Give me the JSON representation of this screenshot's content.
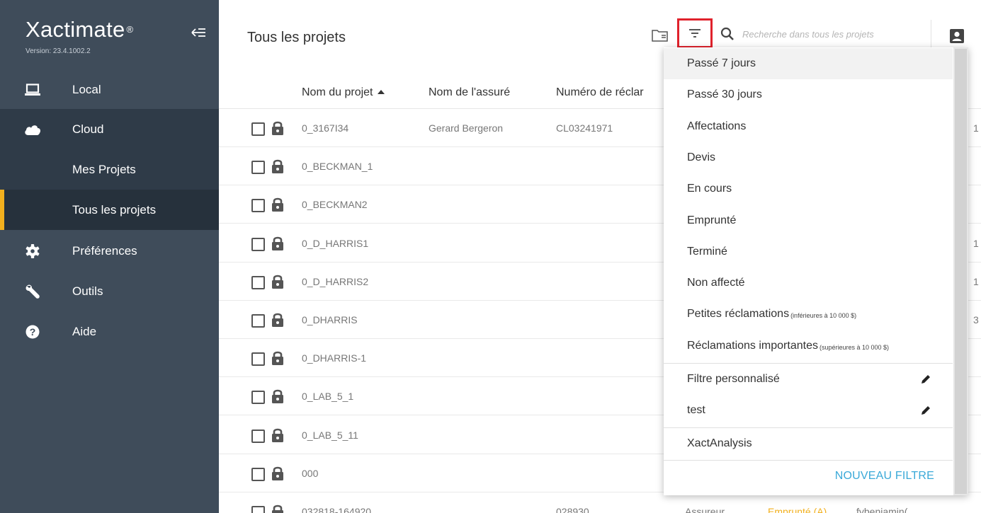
{
  "app": {
    "brand": "Xactimate",
    "registered": "®",
    "version": "Version: 23.4.1002.2"
  },
  "sidebar": {
    "items": [
      {
        "label": "Local",
        "icon": "laptop-icon"
      },
      {
        "label": "Cloud",
        "icon": "cloud-icon"
      },
      {
        "label": "Mes Projets"
      },
      {
        "label": "Tous les projets",
        "active": true
      },
      {
        "label": "Préférences",
        "icon": "gear-icon"
      },
      {
        "label": "Outils",
        "icon": "wrench-icon"
      },
      {
        "label": "Aide",
        "icon": "help-icon"
      }
    ]
  },
  "header": {
    "title": "Tous les projets",
    "search_placeholder": "Recherche dans tous les projets"
  },
  "table": {
    "columns": [
      "Nom du projet",
      "Nom de l'assuré",
      "Numéro de réclar"
    ],
    "rows": [
      {
        "name": "0_3167I34",
        "assure": "Gerard Bergeron",
        "num": "CL03241971",
        "edge": "1"
      },
      {
        "name": "0_BECKMAN_1",
        "assure": "",
        "num": "",
        "edge": ""
      },
      {
        "name": "0_BECKMAN2",
        "assure": "",
        "num": "",
        "edge": ""
      },
      {
        "name": "0_D_HARRIS1",
        "assure": "",
        "num": "",
        "edge": "1"
      },
      {
        "name": "0_D_HARRIS2",
        "assure": "",
        "num": "",
        "edge": "1"
      },
      {
        "name": "0_DHARRIS",
        "assure": "",
        "num": "",
        "edge": "3"
      },
      {
        "name": "0_DHARRIS-1",
        "assure": "",
        "num": "",
        "edge": ""
      },
      {
        "name": "0_LAB_5_1",
        "assure": "",
        "num": "",
        "edge": ""
      },
      {
        "name": "0_LAB_5_11",
        "assure": "",
        "num": "",
        "edge": ""
      },
      {
        "name": "000",
        "assure": "",
        "num": "",
        "edge": ""
      },
      {
        "name": "032818-164920",
        "assure": "",
        "num": "028930",
        "insurer": "Assureur",
        "status": "Emprunté (A)",
        "user": "fybenjamin(",
        "edge": ""
      }
    ]
  },
  "filter_menu": {
    "items": [
      {
        "label": "Passé 7 jours"
      },
      {
        "label": "Passé 30 jours"
      },
      {
        "label": "Affectations"
      },
      {
        "label": "Devis"
      },
      {
        "label": "En cours"
      },
      {
        "label": "Emprunté"
      },
      {
        "label": "Terminé"
      },
      {
        "label": "Non affecté"
      },
      {
        "label": "Petites réclamations",
        "note": "(inférieures à 10 000 $)"
      },
      {
        "label": "Réclamations importantes",
        "note": "(supérieures à 10 000 $)"
      }
    ],
    "custom": [
      {
        "label": "Filtre personnalisé"
      },
      {
        "label": "test"
      }
    ],
    "analysis": "XactAnalysis",
    "new_filter": "NOUVEAU FILTRE"
  },
  "colors": {
    "sidebar_bg": "#3f4c5a",
    "sidebar_selected": "#26313c",
    "accent_yellow": "#f2b01e",
    "filter_highlight": "#e0222c",
    "link_blue": "#3aa9d8"
  }
}
